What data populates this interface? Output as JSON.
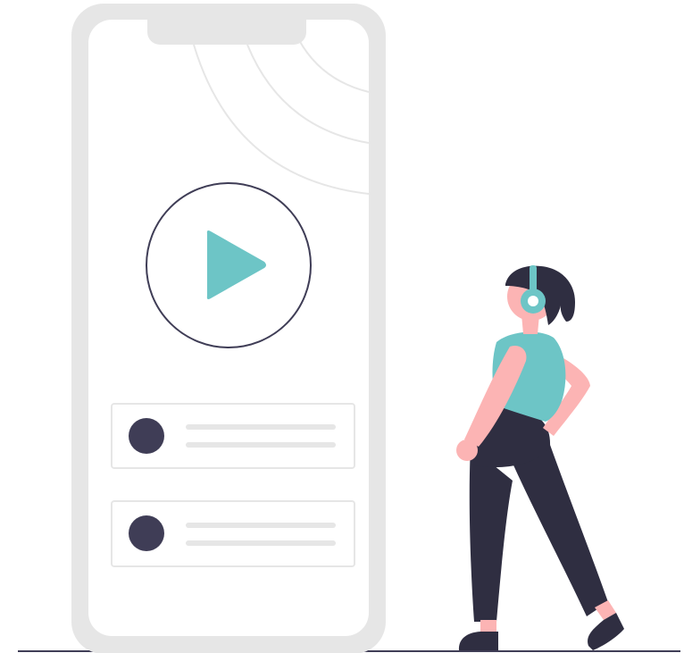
{
  "illustration": {
    "subject": "person-with-headphones-beside-phone-media-player",
    "colors": {
      "phone_frame": "#e6e6e6",
      "screen": "#ffffff",
      "outline": "#3f3d56",
      "accent": "#6dc5c6",
      "skin": "#fcb4b4",
      "clothing": "#2f2e41",
      "hair": "#2f2e41",
      "card_border": "#e6e6e6",
      "placeholder_line": "#e6e6e6",
      "avatar": "#3f3d56",
      "ground": "#3f3d56"
    },
    "phone": {
      "play_button_icon": "play-triangle",
      "playlist": [
        {
          "avatar": "circle",
          "text_lines": 2
        },
        {
          "avatar": "circle",
          "text_lines": 2
        }
      ]
    },
    "person": {
      "headphones_color": "#6dc5c6",
      "shirt_color": "#6dc5c6"
    }
  }
}
